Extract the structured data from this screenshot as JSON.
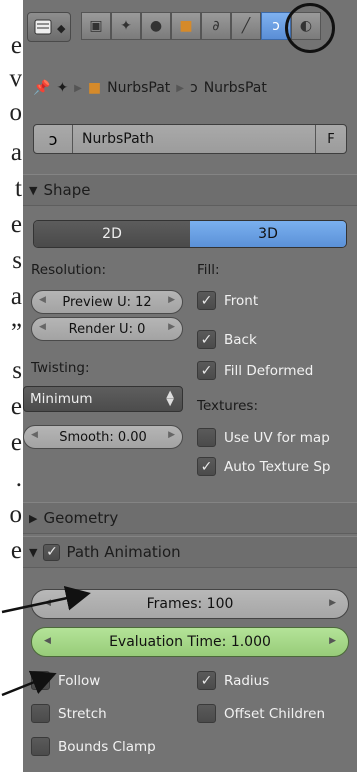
{
  "left_text": [
    "e",
    "v",
    "o",
    "a",
    "t",
    "e",
    "s",
    "a",
    "”",
    "s",
    "e",
    "e",
    ".",
    "o",
    "e"
  ],
  "toolbar": {
    "tabs": [
      {
        "icon": "camera-icon"
      },
      {
        "icon": "scene-icon"
      },
      {
        "icon": "world-icon"
      },
      {
        "icon": "object-icon"
      },
      {
        "icon": "constraint-icon"
      },
      {
        "icon": "modifier-icon"
      },
      {
        "icon": "curve-data-icon",
        "active": true
      },
      {
        "icon": "material-icon"
      }
    ]
  },
  "breadcrumb": {
    "item1": "NurbsPat",
    "item2": "NurbsPat"
  },
  "name_field": {
    "value": "NurbsPath",
    "fake_user": "F"
  },
  "shape": {
    "header": "Shape",
    "dim_2d": "2D",
    "dim_3d": "3D",
    "selected": "3D",
    "resolution_label": "Resolution:",
    "preview_u": "Preview U: 12",
    "render_u": "Render U: 0",
    "twisting_label": "Twisting:",
    "twisting_value": "Minimum",
    "smooth": "Smooth: 0.00",
    "fill_label": "Fill:",
    "front": "Front",
    "back": "Back",
    "fill_deformed": "Fill Deformed",
    "textures_label": "Textures:",
    "use_uv": "Use UV for map",
    "auto_texture": "Auto Texture Sp"
  },
  "geometry": {
    "header": "Geometry"
  },
  "path_animation": {
    "header": "Path Animation",
    "frames": "Frames: 100",
    "eval_time": "Evaluation Time: 1.000",
    "follow": "Follow",
    "radius": "Radius",
    "stretch": "Stretch",
    "offset_children": "Offset Children",
    "bounds_clamp": "Bounds Clamp"
  },
  "colors": {
    "panel": "#737373",
    "accent": "#5b91d8",
    "eval_slider": "#a8d889"
  }
}
